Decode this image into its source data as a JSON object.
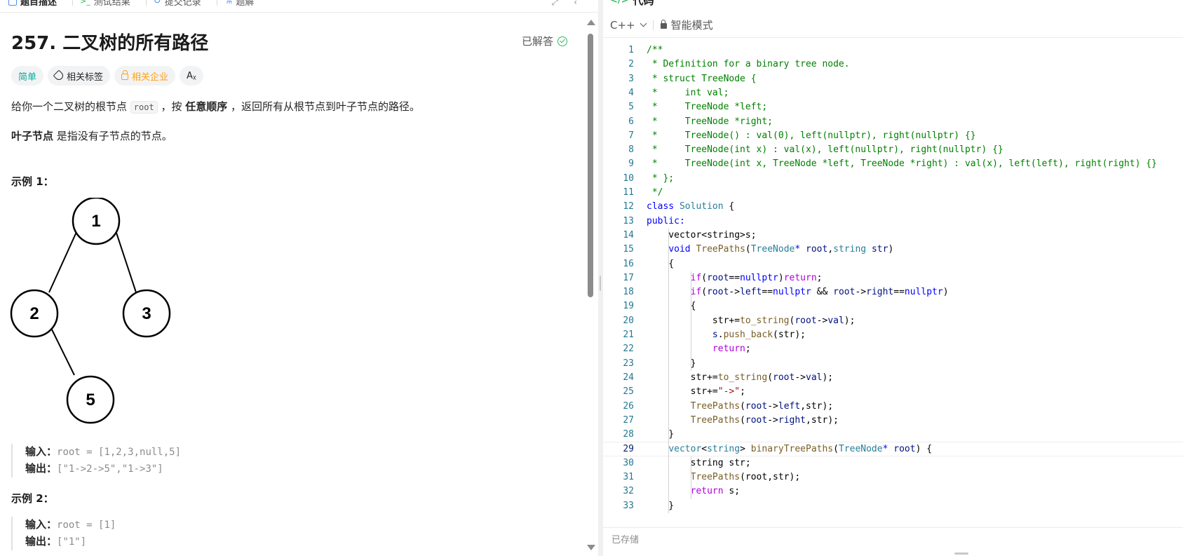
{
  "left_tabs": [
    {
      "label": "题目描述",
      "active": true
    },
    {
      "label": "测试结果",
      "active": false
    },
    {
      "label": "提交记录",
      "active": false
    },
    {
      "label": "题解",
      "active": false
    }
  ],
  "problem": {
    "title": "257. 二叉树的所有路径",
    "status": "已解答"
  },
  "tags": {
    "difficulty": "简单",
    "related_tags": "相关标签",
    "related_companies": "相关企业",
    "translate": "Aᵪ"
  },
  "description": {
    "p1_a": "给你一个二叉树的根节点 ",
    "p1_code": "root",
    "p1_b": " ，按 ",
    "p1_bold": "任意顺序",
    "p1_c": " ，返回所有从根节点到叶子节点的路径。",
    "p2_bold": "叶子节点",
    "p2_rest": " 是指没有子节点的节点。"
  },
  "example1": {
    "title": "示例 1：",
    "tree_nodes": [
      "1",
      "2",
      "3",
      "5"
    ],
    "input_label": "输入：",
    "input_value": "root = [1,2,3,null,5]",
    "output_label": "输出：",
    "output_value": "[\"1->2->5\",\"1->3\"]"
  },
  "example2": {
    "title": "示例 2：",
    "input_label": "输入：",
    "input_value": "root = [1]",
    "output_label": "输出：",
    "output_value": "[\"1\"]"
  },
  "editor": {
    "panel_title": "代码",
    "language": "C++",
    "mode": "智能模式",
    "status": "已存储",
    "current_line": 29,
    "lines": [
      [
        [
          "/**",
          "cm"
        ]
      ],
      [
        [
          " * Definition for a binary tree node.",
          "cm"
        ]
      ],
      [
        [
          " * struct TreeNode {",
          "cm"
        ]
      ],
      [
        [
          " *     int val;",
          "cm"
        ]
      ],
      [
        [
          " *     TreeNode *left;",
          "cm"
        ]
      ],
      [
        [
          " *     TreeNode *right;",
          "cm"
        ]
      ],
      [
        [
          " *     TreeNode() : val(0), left(nullptr), right(nullptr) {}",
          "cm"
        ]
      ],
      [
        [
          " *     TreeNode(int x) : val(x), left(nullptr), right(nullptr) {}",
          "cm"
        ]
      ],
      [
        [
          " *     TreeNode(int x, TreeNode *left, TreeNode *right) : val(x), left(left), right(right) {}",
          "cm"
        ]
      ],
      [
        [
          " * };",
          "cm"
        ]
      ],
      [
        [
          " */",
          "cm"
        ]
      ],
      [
        [
          "class ",
          "kw"
        ],
        [
          "Solution",
          "ty"
        ],
        [
          " {",
          "pl"
        ]
      ],
      [
        [
          "public:",
          "kw"
        ]
      ],
      [
        [
          "    vector<string>s;",
          "pl"
        ]
      ],
      [
        [
          "    ",
          "pl"
        ],
        [
          "void ",
          "kw"
        ],
        [
          "TreePaths",
          "fn"
        ],
        [
          "(",
          "pl"
        ],
        [
          "TreeNode",
          "ty"
        ],
        [
          "* ",
          "kw"
        ],
        [
          "root",
          "var"
        ],
        [
          ",",
          "pl"
        ],
        [
          "string ",
          "ty"
        ],
        [
          "str",
          "var"
        ],
        [
          ")",
          "pl"
        ]
      ],
      [
        [
          "    {",
          "pl"
        ]
      ],
      [
        [
          "        ",
          "pl"
        ],
        [
          "if",
          "ctl"
        ],
        [
          "(",
          "pl"
        ],
        [
          "root",
          "var"
        ],
        [
          "==",
          "pl"
        ],
        [
          "nullptr",
          "kw"
        ],
        [
          ")",
          "pl"
        ],
        [
          "return",
          "ctl"
        ],
        [
          ";",
          "pl"
        ]
      ],
      [
        [
          "        ",
          "pl"
        ],
        [
          "if",
          "ctl"
        ],
        [
          "(",
          "pl"
        ],
        [
          "root",
          "var"
        ],
        [
          "->",
          "pl"
        ],
        [
          "left",
          "var"
        ],
        [
          "==",
          "pl"
        ],
        [
          "nullptr",
          "kw"
        ],
        [
          " && ",
          "pl"
        ],
        [
          "root",
          "var"
        ],
        [
          "->",
          "pl"
        ],
        [
          "right",
          "var"
        ],
        [
          "==",
          "pl"
        ],
        [
          "nullptr",
          "kw"
        ],
        [
          ")",
          "pl"
        ]
      ],
      [
        [
          "        {",
          "pl"
        ]
      ],
      [
        [
          "            str+=",
          "pl"
        ],
        [
          "to_string",
          "fn"
        ],
        [
          "(",
          "pl"
        ],
        [
          "root",
          "var"
        ],
        [
          "->",
          "pl"
        ],
        [
          "val",
          "var"
        ],
        [
          ");",
          "pl"
        ]
      ],
      [
        [
          "            ",
          "pl"
        ],
        [
          "s",
          "var"
        ],
        [
          ".",
          "pl"
        ],
        [
          "push_back",
          "fn"
        ],
        [
          "(str);",
          "pl"
        ]
      ],
      [
        [
          "            ",
          "pl"
        ],
        [
          "return",
          "ctl"
        ],
        [
          ";",
          "pl"
        ]
      ],
      [
        [
          "        }",
          "pl"
        ]
      ],
      [
        [
          "        str+=",
          "pl"
        ],
        [
          "to_string",
          "fn"
        ],
        [
          "(",
          "pl"
        ],
        [
          "root",
          "var"
        ],
        [
          "->",
          "pl"
        ],
        [
          "val",
          "var"
        ],
        [
          ");",
          "pl"
        ]
      ],
      [
        [
          "        str+=",
          "pl"
        ],
        [
          "\"->\"",
          "str"
        ],
        [
          ";",
          "pl"
        ]
      ],
      [
        [
          "        ",
          "pl"
        ],
        [
          "TreePaths",
          "fn"
        ],
        [
          "(",
          "pl"
        ],
        [
          "root",
          "var"
        ],
        [
          "->",
          "pl"
        ],
        [
          "left",
          "var"
        ],
        [
          ",str);",
          "pl"
        ]
      ],
      [
        [
          "        ",
          "pl"
        ],
        [
          "TreePaths",
          "fn"
        ],
        [
          "(",
          "pl"
        ],
        [
          "root",
          "var"
        ],
        [
          "->",
          "pl"
        ],
        [
          "right",
          "var"
        ],
        [
          ",str);",
          "pl"
        ]
      ],
      [
        [
          "    }",
          "pl"
        ]
      ],
      [
        [
          "    ",
          "pl"
        ],
        [
          "vector",
          "ty"
        ],
        [
          "<",
          "pl"
        ],
        [
          "string",
          "ty"
        ],
        [
          "> ",
          "pl"
        ],
        [
          "binaryTreePaths",
          "fn"
        ],
        [
          "(",
          "pl"
        ],
        [
          "TreeNode",
          "ty"
        ],
        [
          "* ",
          "kw"
        ],
        [
          "root",
          "var"
        ],
        [
          ") {",
          "pl"
        ]
      ],
      [
        [
          "        string str;",
          "pl"
        ]
      ],
      [
        [
          "        ",
          "pl"
        ],
        [
          "TreePaths",
          "fn"
        ],
        [
          "(root,str);",
          "pl"
        ]
      ],
      [
        [
          "        ",
          "pl"
        ],
        [
          "return",
          "ctl"
        ],
        [
          " s;",
          "pl"
        ]
      ],
      [
        [
          "    }",
          "pl"
        ]
      ]
    ]
  }
}
